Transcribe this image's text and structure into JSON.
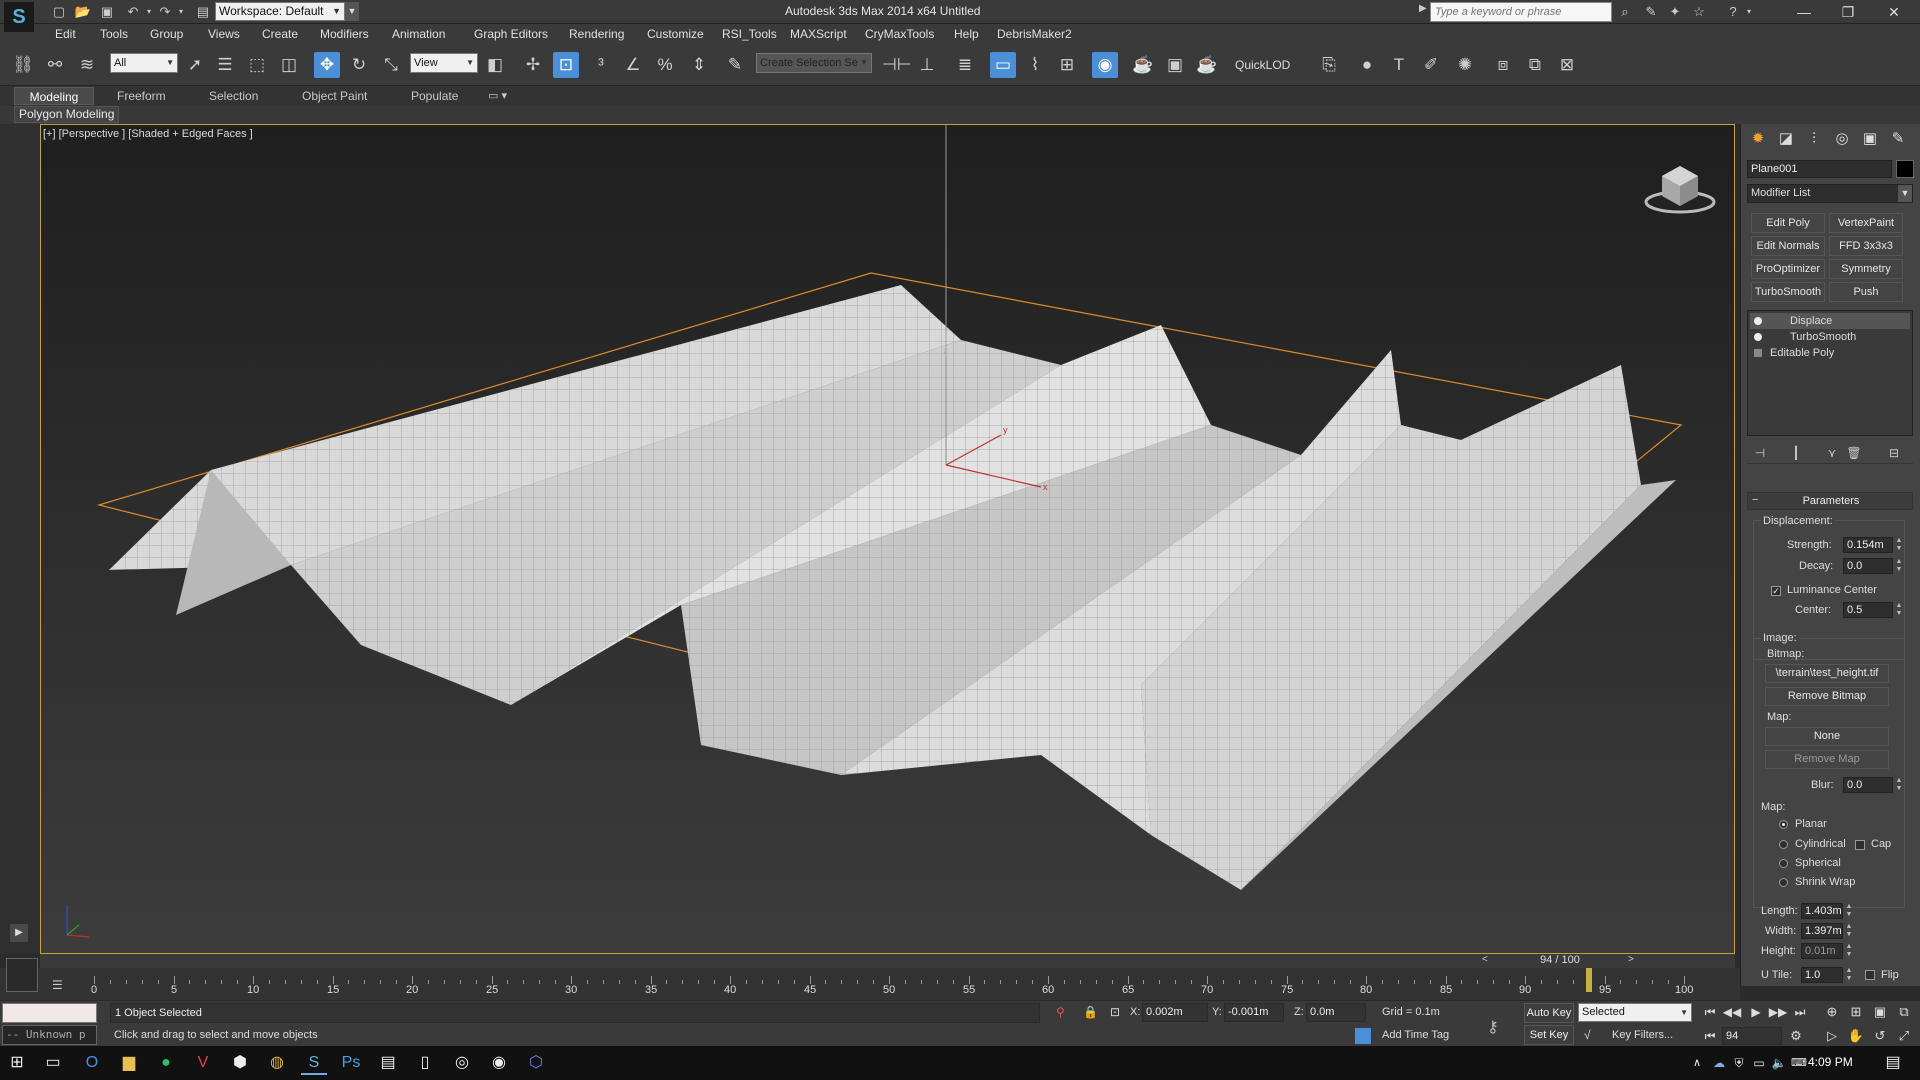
{
  "title_bar": {
    "workspace_value": "Workspace: Default",
    "window_title": "Autodesk 3ds Max  2014 x64      Untitled",
    "search_placeholder": "Type a keyword or phrase"
  },
  "menu": [
    "Edit",
    "Tools",
    "Group",
    "Views",
    "Create",
    "Modifiers",
    "Animation",
    "Graph Editors",
    "Rendering",
    "Customize",
    "RSI_Tools",
    "MAXScript",
    "CryMaxTools",
    "Help",
    "DebrisMaker2"
  ],
  "toolbar": {
    "selection_filter": "All",
    "reference_coord": "View",
    "named_selection_placeholder": "Create Selection Se",
    "quicklod_label": "QuickLOD"
  },
  "ribbon": {
    "tabs": [
      "Modeling",
      "Freeform",
      "Selection",
      "Object Paint",
      "Populate"
    ],
    "active_tab": "Modeling",
    "panel_label": "Polygon Modeling"
  },
  "viewport": {
    "label": "[+] [Perspective ] [Shaded + Edged Faces ]",
    "selection_color": "#e08a2a"
  },
  "command_panel": {
    "object_name": "Plane001",
    "modifier_list": "Modifier List",
    "modifier_buttons": [
      "Edit Poly",
      "VertexPaint",
      "Edit Normals",
      "FFD 3x3x3",
      "ProOptimizer",
      "Symmetry",
      "TurboSmooth",
      "Push"
    ],
    "stack": [
      {
        "name": "Displace",
        "selected": true
      },
      {
        "name": "TurboSmooth",
        "selected": false
      },
      {
        "name": "Editable Poly",
        "selected": false
      }
    ],
    "parameters": {
      "header": "Parameters",
      "displacement_label": "Displacement:",
      "strength_label": "Strength:",
      "strength_value": "0.154m",
      "decay_label": "Decay:",
      "decay_value": "0.0",
      "luminance_center_label": "Luminance Center",
      "luminance_center_checked": true,
      "center_label": "Center:",
      "center_value": "0.5",
      "image_label": "Image:",
      "bitmap_label": "Bitmap:",
      "bitmap_value": "\\terrain\\test_height.tif",
      "remove_bitmap": "Remove Bitmap",
      "map_label": "Map:",
      "map_value": "None",
      "remove_map": "Remove Map",
      "blur_label": "Blur:",
      "blur_value": "0.0",
      "mapping_label": "Map:",
      "mapping_options": [
        "Planar",
        "Cylindrical",
        "Spherical",
        "Shrink Wrap"
      ],
      "mapping_selected": "Planar",
      "cap_label": "Cap",
      "length_label": "Length:",
      "length_value": "1.403m",
      "width_label": "Width:",
      "width_value": "1.397m",
      "height_label": "Height:",
      "height_value": "0.01m",
      "utile_label": "U Tile:",
      "utile_value": "1.0",
      "flip_label": "Flip"
    }
  },
  "timeline": {
    "slider_label": "94 / 100",
    "current_frame": 94,
    "frame_end": 100,
    "tick_labels": [
      "0",
      "5",
      "10",
      "15",
      "20",
      "25",
      "30",
      "35",
      "40",
      "45",
      "50",
      "55",
      "60",
      "65",
      "70",
      "75",
      "80",
      "85",
      "90",
      "95",
      "100"
    ]
  },
  "status": {
    "maxscript_text": "-- Unknown p",
    "selection": "1 Object Selected",
    "prompt": "Click and drag to select and move objects",
    "x_label": "X:",
    "x_value": "0.002m",
    "y_label": "Y:",
    "y_value": "-0.001m",
    "z_label": "Z:",
    "z_value": "0.0m",
    "grid": "Grid = 0.1m",
    "add_time_tag": "Add Time Tag",
    "auto_key": "Auto Key",
    "set_key": "Set Key",
    "selected_dropdown": "Selected",
    "key_filters": "Key Filters...",
    "frame_field": "94"
  },
  "taskbar": {
    "time": "4:09 PM"
  }
}
